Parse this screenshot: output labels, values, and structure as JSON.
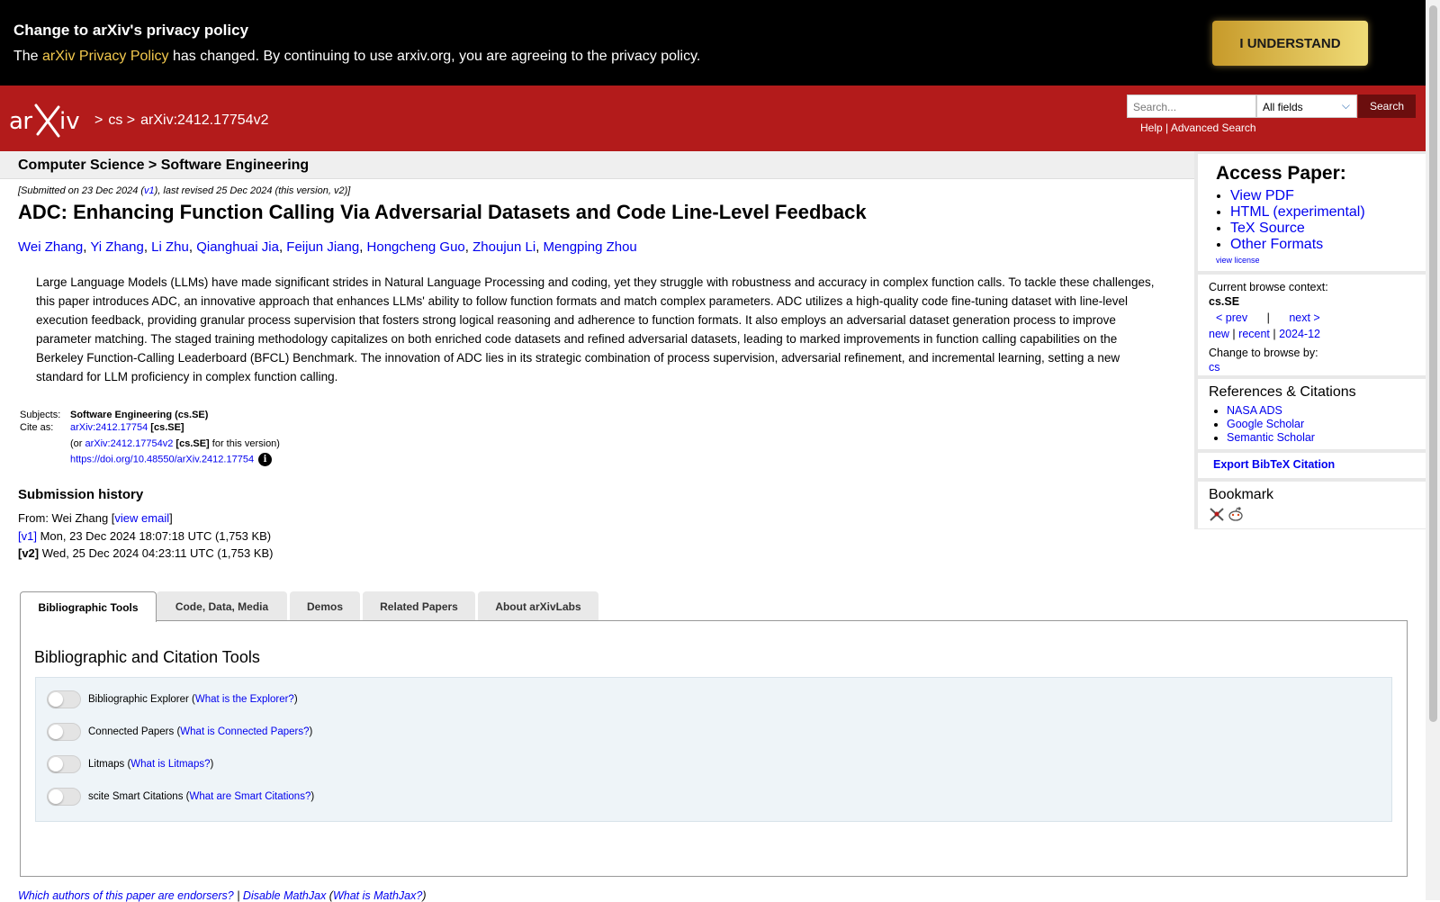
{
  "privacy": {
    "title": "Change to arXiv's privacy policy",
    "text_before": "The ",
    "link": "arXiv Privacy Policy",
    "text_after": " has changed. By continuing to use arxiv.org, you are agreeing to the privacy policy.",
    "button": "I UNDERSTAND"
  },
  "header": {
    "breadcrumb": [
      ">",
      "cs",
      ">",
      "arXiv:2412.17754v2"
    ],
    "search_placeholder": "Search...",
    "field_select": "All fields",
    "search_button": "Search",
    "help": "Help",
    "sep": "|",
    "advanced": "Advanced Search"
  },
  "subheader": "Computer Science > Software Engineering",
  "paper": {
    "dateline_pre": "[Submitted on 23 Dec 2024 (",
    "dateline_v1": "v1",
    "dateline_post": "), last revised 25 Dec 2024 (this version, v2)]",
    "title": "ADC: Enhancing Function Calling Via Adversarial Datasets and Code Line-Level Feedback",
    "authors": [
      "Wei Zhang",
      "Yi Zhang",
      "Li Zhu",
      "Qianghuai Jia",
      "Feijun Jiang",
      "Hongcheng Guo",
      "Zhoujun Li",
      "Mengping Zhou"
    ],
    "abstract": "Large Language Models (LLMs) have made significant strides in Natural Language Processing and coding, yet they struggle with robustness and accuracy in complex function calls. To tackle these challenges, this paper introduces ADC, an innovative approach that enhances LLMs' ability to follow function formats and match complex parameters. ADC utilizes a high-quality code fine-tuning dataset with line-level execution feedback, providing granular process supervision that fosters strong logical reasoning and adherence to function formats. It also employs an adversarial dataset generation process to improve parameter matching. The staged training methodology capitalizes on both enriched code datasets and refined adversarial datasets, leading to marked improvements in function calling capabilities on the Berkeley Function-Calling Leaderboard (BFCL) Benchmark. The innovation of ADC lies in its strategic combination of process supervision, adversarial refinement, and incremental learning, setting a new standard for LLM proficiency in complex function calling.",
    "subjects_label": "Subjects:",
    "subjects_value": "Software Engineering (cs.SE)",
    "cite_label": "Cite as:",
    "cite_id": "arXiv:2412.17754",
    "cite_tag": "[cs.SE]",
    "cite_or": "(or ",
    "cite_v2": "arXiv:2412.17754v2",
    "cite_v2_tag": "[cs.SE]",
    "cite_v2_post": " for this version)",
    "doi": "https://doi.org/10.48550/arXiv.2412.17754",
    "info_glyph": "i"
  },
  "history": {
    "title": "Submission history",
    "from_label": "From: Wei Zhang [",
    "view_email": "view email",
    "from_close": "]",
    "v1_label": "[v1]",
    "v1_text": " Mon, 23 Dec 2024 18:07:18 UTC (1,753 KB)",
    "v2_label": "[v2]",
    "v2_text": " Wed, 25 Dec 2024 04:23:11 UTC (1,753 KB)"
  },
  "sidebar": {
    "access_title": "Access Paper:",
    "access_links": [
      "View PDF",
      "HTML (experimental)",
      "TeX Source",
      "Other Formats"
    ],
    "view_license": "view license",
    "context_label": "Current browse context:",
    "context_value": "cs.SE",
    "prev": "< prev",
    "pipe": "|",
    "next": "next >",
    "new": "new",
    "recent": "recent",
    "month": "2024-12",
    "change_label": "Change to browse by:",
    "change_value": "cs",
    "refs_title": "References & Citations",
    "refs": [
      "NASA ADS",
      "Google Scholar",
      "Semantic Scholar"
    ],
    "export": "Export BibTeX Citation",
    "bookmark_title": "Bookmark"
  },
  "tabs": [
    "Bibliographic Tools",
    "Code, Data, Media",
    "Demos",
    "Related Papers",
    "About arXivLabs"
  ],
  "panel": {
    "title": "Bibliographic and Citation Tools",
    "toggles": [
      {
        "label": "Bibliographic Explorer (",
        "link": "What is the Explorer?",
        "close": ")"
      },
      {
        "label": "Connected Papers (",
        "link": "What is Connected Papers?",
        "close": ")"
      },
      {
        "label": "Litmaps (",
        "link": "What is Litmaps?",
        "close": ")"
      },
      {
        "label": "scite Smart Citations (",
        "link": "What are Smart Citations?",
        "close": ")"
      }
    ]
  },
  "footer": {
    "endorsers": "Which authors of this paper are endorsers?",
    "sep": " | ",
    "mathjax": "Disable MathJax",
    "what_mathjax_open": " (",
    "what_mathjax": "What is MathJax?",
    "what_mathjax_close": ")"
  },
  "colors": {
    "brand_red": "#b31b1b",
    "banner_bg": "#000000",
    "gold": "#f3c94e",
    "link_blue": "#0000ee"
  }
}
